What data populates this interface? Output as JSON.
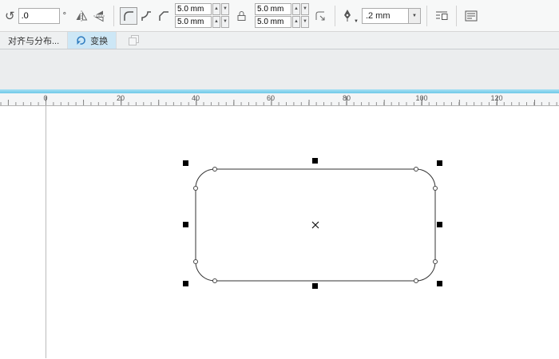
{
  "glyphs": {
    "rotation": "↺",
    "spin_up": "▲",
    "spin_down": "▼",
    "dropdown": "▼",
    "degree": "°"
  },
  "property_bar": {
    "rotation_angle": ".0",
    "corner_radius": {
      "group1_top": "5.0 mm",
      "group1_bottom": "5.0 mm",
      "group2_top": "5.0 mm",
      "group2_bottom": "5.0 mm"
    },
    "outline_width": ".2 mm"
  },
  "docker_tabs": {
    "align_distribute_label": "对齐与分布...",
    "transform_label": "变换"
  },
  "ruler": {
    "ticks": [
      "0",
      "20",
      "40",
      "60",
      "80",
      "100",
      "120"
    ]
  },
  "colors": {
    "accent_strip": "#6ec9e8",
    "tab_active_bg": "#cde7f6",
    "selection_handle": "#000000",
    "shape_outline": "#333333"
  }
}
